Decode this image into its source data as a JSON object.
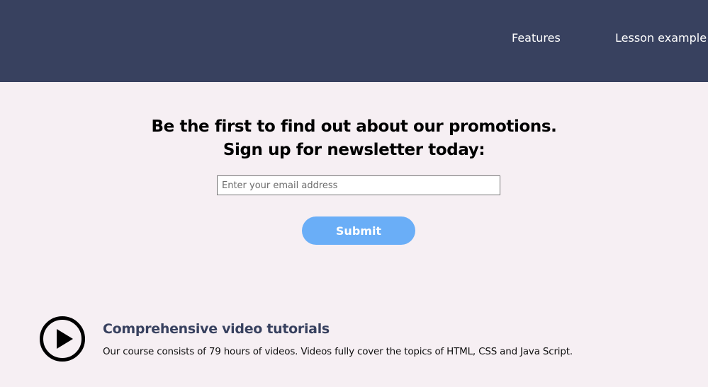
{
  "header": {
    "nav": [
      {
        "label": "Features"
      },
      {
        "label": "Lesson example"
      }
    ],
    "background_color": "#38415f"
  },
  "newsletter": {
    "headline_line1": "Be the first to find out about our promotions.",
    "headline_line2": "Sign up for newsletter today:",
    "email_placeholder": "Enter your email address",
    "email_value": "",
    "submit_label": "Submit",
    "submit_color": "#6aaef7"
  },
  "features": [
    {
      "icon": "play-circle-icon",
      "title": "Comprehensive video tutorials",
      "description": "Our course consists of 79 hours of videos. Videos fully cover the topics of HTML, CSS and Java Script."
    }
  ],
  "colors": {
    "page_background": "#f6eff3",
    "accent_dark": "#38415f"
  }
}
